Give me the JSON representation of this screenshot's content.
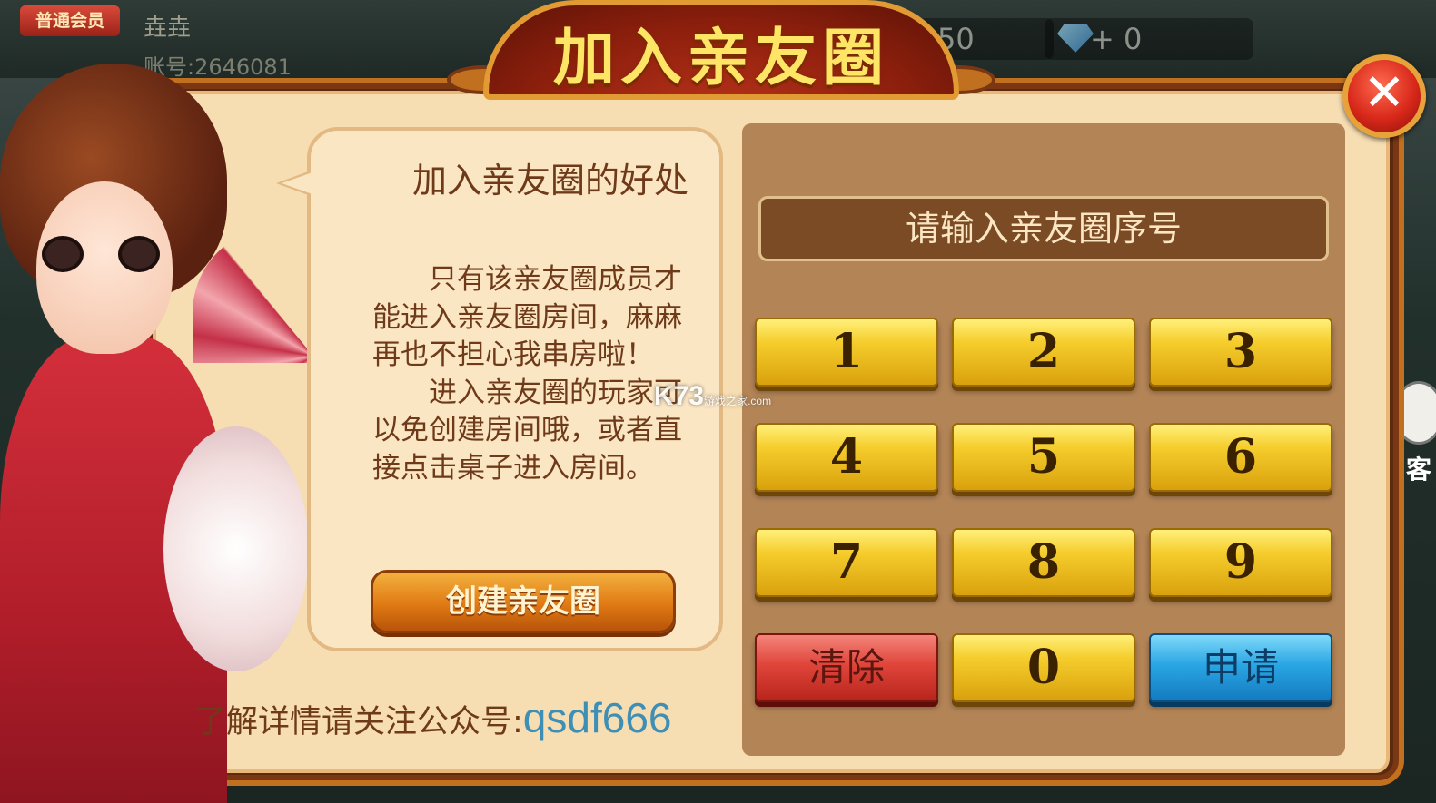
{
  "topbar": {
    "vip_badge": "普通会员",
    "username": "垚垚",
    "account_id": "账号:2646081",
    "coins": "50",
    "gems": "+ 0"
  },
  "dialog": {
    "title": "加入亲友圈",
    "close_icon": "close-icon",
    "bubble_title": "加入亲友圈的好处",
    "bubble_paragraph_1": "只有该亲友圈成员才能进入亲友圈房间，麻麻再也不担心我串房啦！",
    "bubble_paragraph_2": "进入亲友圈的玩家可以免创建房间哦，或者直接点击桌子进入房间。",
    "create_button": "创建亲友圈",
    "footer_label": "了解详情请关注公众号:",
    "footer_value": "qsdf666"
  },
  "keypad": {
    "placeholder": "请输入亲友圈序号",
    "keys": [
      "1",
      "2",
      "3",
      "4",
      "5",
      "6",
      "7",
      "8",
      "9"
    ],
    "clear": "清除",
    "zero": "0",
    "apply": "申请"
  },
  "side": {
    "service_label": "客"
  },
  "watermark": {
    "brand": "K73",
    "sub": "游戏之家",
    "domain": ".com"
  },
  "colors": {
    "accent_brown": "#6e3a1a",
    "gold_key": "#f5cd2c",
    "clear_red": "#e0453a",
    "apply_blue": "#2aa6e4",
    "link_blue": "#3d8fb6"
  }
}
